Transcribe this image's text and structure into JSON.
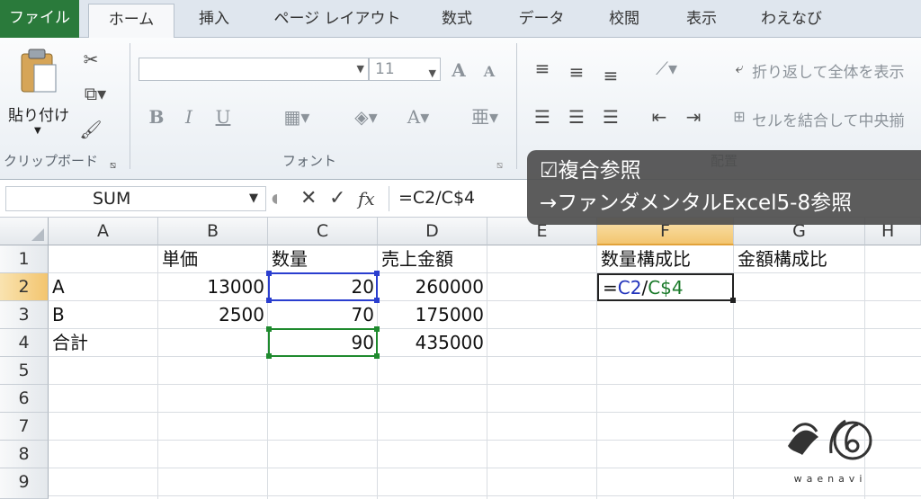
{
  "tabs": [
    "ファイル",
    "ホーム",
    "挿入",
    "ページ レイアウト",
    "数式",
    "データ",
    "校閲",
    "表示",
    "わえなび"
  ],
  "ribbon": {
    "paste_label": "貼り付け",
    "clipboard_label": "クリップボード",
    "font_label": "フォント",
    "alignment_label": "配置",
    "font_size": "11",
    "bold": "B",
    "italic": "I",
    "underline": "U",
    "grow_font": "A",
    "shrink_font": "A",
    "wrap_text": "折り返して全体を表示",
    "merge_center": "セルを結合して中央揃"
  },
  "formula_bar": {
    "name_box": "SUM",
    "formula": "=C2/C$4"
  },
  "columns": [
    "A",
    "B",
    "C",
    "D",
    "E",
    "F",
    "G",
    "H"
  ],
  "rows": [
    "1",
    "2",
    "3",
    "4",
    "5",
    "6",
    "7",
    "8",
    "9"
  ],
  "cells": {
    "B1": "単価",
    "C1": "数量",
    "D1": "売上金額",
    "F1": "数量構成比",
    "G1": "金額構成比",
    "A2": "A",
    "B2": "13000",
    "C2": "20",
    "D2": "260000",
    "F2": "=C2/C$4",
    "A3": "B",
    "B3": "2500",
    "C3": "70",
    "D3": "175000",
    "A4": "合計",
    "C4": "90",
    "D4": "435000"
  },
  "overlay": {
    "line1": "☑複合参照",
    "line2": "→ファンダメンタルExcel5-8参照"
  },
  "logo_text": "waenavi",
  "colors": {
    "file_tab": "#2a7a3b",
    "ref_blue": "#2233bb",
    "ref_green": "#1a7a2a",
    "selected_header": "#f3c56f"
  }
}
